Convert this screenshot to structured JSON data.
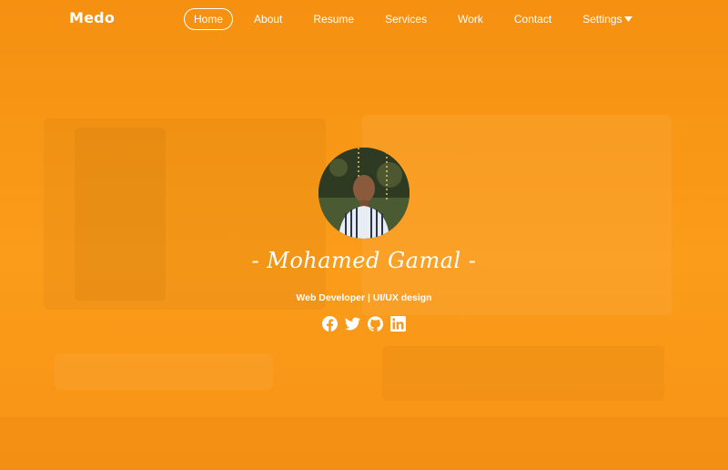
{
  "brand": {
    "name": "Medo"
  },
  "nav": {
    "items": [
      {
        "label": "Home",
        "active": true
      },
      {
        "label": "About"
      },
      {
        "label": "Resume"
      },
      {
        "label": "Services"
      },
      {
        "label": "Work"
      },
      {
        "label": "Contact"
      },
      {
        "label": "Settings",
        "has_dropdown": true,
        "caret_icon": "caret-down-icon"
      }
    ]
  },
  "hero": {
    "name": "- Mohamed Gamal -",
    "role": "Web Developer | UI/UX design",
    "socials": [
      {
        "icon": "facebook-icon"
      },
      {
        "icon": "twitter-icon"
      },
      {
        "icon": "github-icon"
      },
      {
        "icon": "linkedin-icon"
      }
    ]
  },
  "colors": {
    "accent": "#f79410",
    "text": "#ffffff"
  }
}
